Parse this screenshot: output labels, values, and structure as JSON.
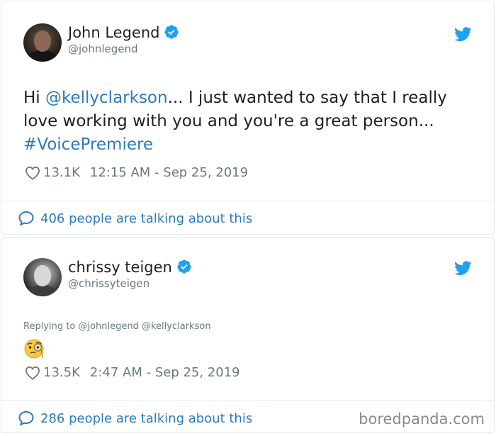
{
  "tweets": [
    {
      "author_name": "John Legend",
      "handle": "@johnlegend",
      "text_parts": {
        "greeting": "Hi ",
        "mention": "@kellyclarkson",
        "body": "... I just wanted to say that I really love working with you and you're a great person... ",
        "hashtag": "#VoicePremiere"
      },
      "likes": "13.1K",
      "timestamp": "12:15 AM - Sep 25, 2019",
      "talking": "406 people are talking about this",
      "verified_icon": "verified-badge-icon",
      "platform_icon": "twitter-bird-icon"
    },
    {
      "author_name": "chrissy teigen",
      "handle": "@chrissyteigen",
      "replying_to": "Replying to @johnlegend @kellyclarkson",
      "emoji": "face-with-monocle",
      "likes": "13.5K",
      "timestamp": "2:47 AM - Sep 25, 2019",
      "talking": "286 people are talking about this",
      "verified_icon": "verified-badge-icon",
      "platform_icon": "twitter-bird-icon"
    }
  ],
  "watermark": "boredpanda.com",
  "colors": {
    "link": "#2b7bb9",
    "verified": "#1da1f2",
    "meta_text": "#697882",
    "border": "#e1e8ed"
  }
}
